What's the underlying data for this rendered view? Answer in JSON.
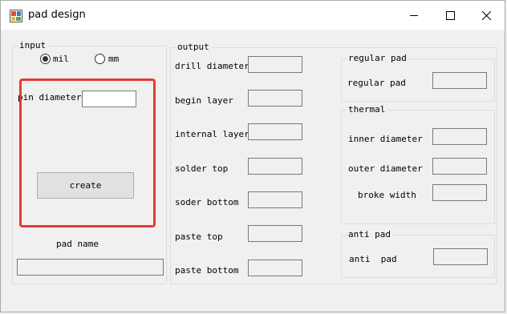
{
  "window": {
    "title": "pad design"
  },
  "input": {
    "group_label": "input",
    "radio_mil": "mil",
    "radio_mm": "mm",
    "pin_diameter_label": "pin diameter",
    "pin_diameter_value": "",
    "create_button": "create",
    "pad_name_label": "pad name",
    "pad_name_value": ""
  },
  "output": {
    "group_label": "output",
    "fields": [
      {
        "label": "drill diameter",
        "value": ""
      },
      {
        "label": "begin layer",
        "value": ""
      },
      {
        "label": "internal layer",
        "value": ""
      },
      {
        "label": "solder top",
        "value": ""
      },
      {
        "label": "soder bottom",
        "value": ""
      },
      {
        "label": "paste top",
        "value": ""
      },
      {
        "label": "paste bottom",
        "value": ""
      }
    ]
  },
  "regular_pad": {
    "group_label": "regular pad",
    "label": "regular pad",
    "value": ""
  },
  "thermal": {
    "group_label": "thermal",
    "inner_label": "inner diameter",
    "inner_value": "",
    "outer_label": "outer diameter",
    "outer_value": "",
    "broke_label": "broke width",
    "broke_value": ""
  },
  "anti_pad": {
    "group_label": "anti pad",
    "label": "anti  pad",
    "value": ""
  },
  "colors": {
    "highlight": "#e53935"
  }
}
